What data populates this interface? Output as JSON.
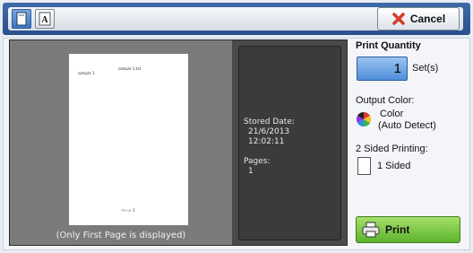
{
  "toolbar": {
    "cancel_label": "Cancel"
  },
  "preview": {
    "page_header_left": "sample 1",
    "page_header_right": "sample 1.txt",
    "page_footer": "ページ 1",
    "caption": "(Only First Page is displayed)"
  },
  "info": {
    "stored_date_label": "Stored Date:",
    "stored_date": "21/6/2013",
    "stored_time": "12:02:11",
    "pages_label": "Pages:",
    "pages_value": "1"
  },
  "quantity": {
    "label": "Print Quantity",
    "value": "1",
    "unit": "Set(s)"
  },
  "output_color": {
    "label": "Output Color:",
    "value_line1": "Color",
    "value_line2": "(Auto Detect)"
  },
  "two_sided": {
    "label": "2 Sided Printing:",
    "value": "1 Sided"
  },
  "print_button": {
    "label": "Print"
  },
  "colors": {
    "accent_blue": "#3d74c0",
    "print_green": "#5db32c",
    "cancel_red": "#d63a2a"
  }
}
